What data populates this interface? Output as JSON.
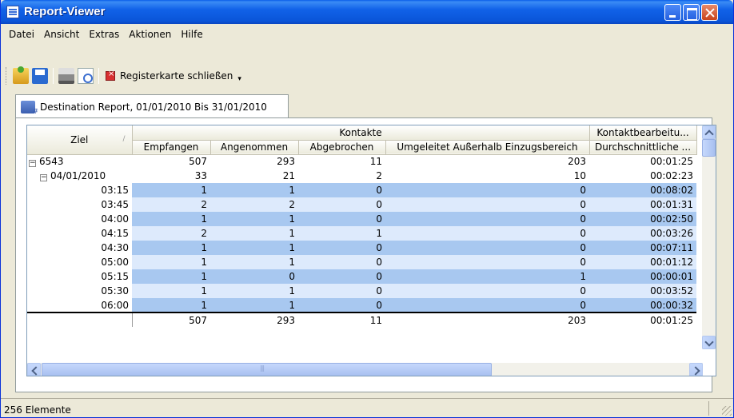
{
  "window": {
    "title": "Report-Viewer"
  },
  "menu": [
    "Datei",
    "Ansicht",
    "Extras",
    "Aktionen",
    "Hilfe"
  ],
  "toolbar": {
    "close_tab_label": "Registerkarte schließen"
  },
  "tab": {
    "label": "Destination Report, 01/01/2010 Bis 31/01/2010"
  },
  "grid": {
    "headers": {
      "ziel": "Ziel",
      "group_kontakte": "Kontakte",
      "group_bearbeitung": "Kontaktbearbeitu...",
      "empfangen": "Empfangen",
      "angenommen": "Angenommen",
      "abgebrochen": "Abgebrochen",
      "umgeleitet": "Umgeleitet Außerhalb Einzugsbereich",
      "durchschnitt": "Durchschnittliche ..."
    },
    "rows": [
      {
        "label": "6543",
        "level": 0,
        "expander": "−",
        "empfangen": "507",
        "angenommen": "293",
        "abgebrochen": "11",
        "umgeleitet": "203",
        "durchschnitt": "00:01:25"
      },
      {
        "label": "04/01/2010",
        "level": 1,
        "expander": "−",
        "empfangen": "33",
        "angenommen": "21",
        "abgebrochen": "2",
        "umgeleitet": "10",
        "durchschnitt": "00:02:23"
      },
      {
        "label": "03:15",
        "level": 2,
        "empfangen": "1",
        "angenommen": "1",
        "abgebrochen": "0",
        "umgeleitet": "0",
        "durchschnitt": "00:08:02"
      },
      {
        "label": "03:45",
        "level": 2,
        "empfangen": "2",
        "angenommen": "2",
        "abgebrochen": "0",
        "umgeleitet": "0",
        "durchschnitt": "00:01:31"
      },
      {
        "label": "04:00",
        "level": 2,
        "empfangen": "1",
        "angenommen": "1",
        "abgebrochen": "0",
        "umgeleitet": "0",
        "durchschnitt": "00:02:50"
      },
      {
        "label": "04:15",
        "level": 2,
        "empfangen": "2",
        "angenommen": "1",
        "abgebrochen": "1",
        "umgeleitet": "0",
        "durchschnitt": "00:03:26"
      },
      {
        "label": "04:30",
        "level": 2,
        "empfangen": "1",
        "angenommen": "1",
        "abgebrochen": "0",
        "umgeleitet": "0",
        "durchschnitt": "00:07:11"
      },
      {
        "label": "05:00",
        "level": 2,
        "empfangen": "1",
        "angenommen": "1",
        "abgebrochen": "0",
        "umgeleitet": "0",
        "durchschnitt": "00:01:12"
      },
      {
        "label": "05:15",
        "level": 2,
        "empfangen": "1",
        "angenommen": "0",
        "abgebrochen": "0",
        "umgeleitet": "1",
        "durchschnitt": "00:00:01"
      },
      {
        "label": "05:30",
        "level": 2,
        "empfangen": "1",
        "angenommen": "1",
        "abgebrochen": "0",
        "umgeleitet": "0",
        "durchschnitt": "00:03:52"
      },
      {
        "label": "06:00",
        "level": 2,
        "empfangen": "1",
        "angenommen": "1",
        "abgebrochen": "0",
        "umgeleitet": "0",
        "durchschnitt": "00:00:32"
      }
    ],
    "totals": {
      "empfangen": "507",
      "angenommen": "293",
      "abgebrochen": "11",
      "umgeleitet": "203",
      "durchschnitt": "00:01:25"
    }
  },
  "status": {
    "text": "256 Elemente"
  }
}
